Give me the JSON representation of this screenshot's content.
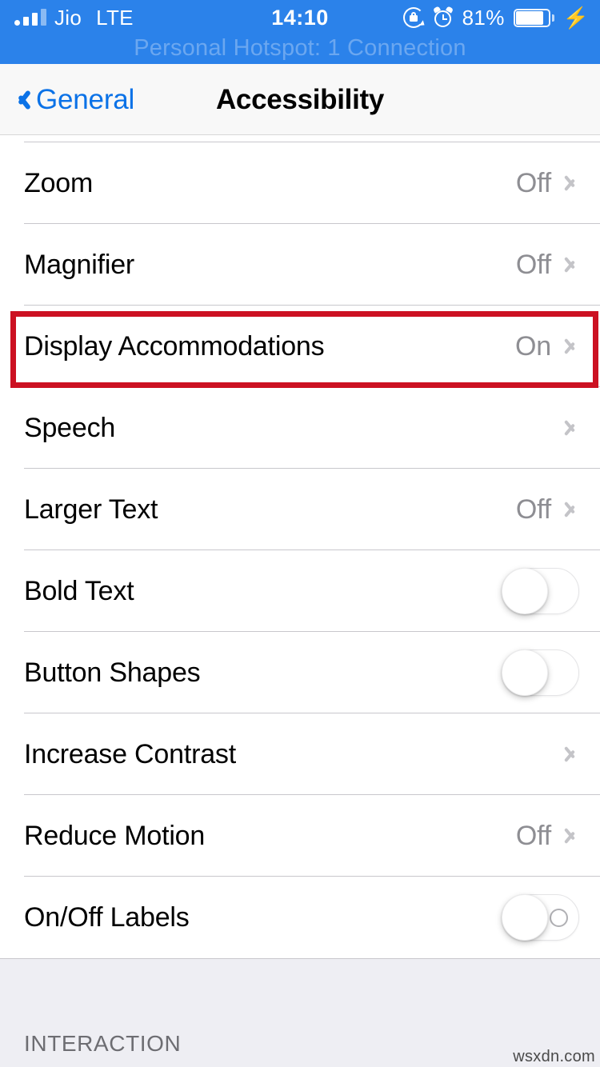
{
  "status_bar": {
    "carrier": "Jio",
    "network": "LTE",
    "time": "14:10",
    "battery_percent": "81%",
    "icons": {
      "signal": "signal-bars-icon",
      "rotation_lock": "rotation-lock-icon",
      "alarm": "alarm-clock-icon",
      "battery": "battery-icon",
      "charging": "charging-bolt-icon"
    },
    "accent_color": "#2b82ea"
  },
  "hotspot_banner": {
    "text": "Personal Hotspot: 1 Connection"
  },
  "nav": {
    "back_label": "General",
    "title": "Accessibility",
    "tint_color": "#0b72e7"
  },
  "vision_section": {
    "rows": [
      {
        "label": "Zoom",
        "value": "Off",
        "control": "chevron"
      },
      {
        "label": "Magnifier",
        "value": "Off",
        "control": "chevron"
      },
      {
        "label": "Display Accommodations",
        "value": "On",
        "control": "chevron",
        "highlighted": true
      },
      {
        "label": "Speech",
        "value": "",
        "control": "chevron"
      },
      {
        "label": "Larger Text",
        "value": "Off",
        "control": "chevron"
      },
      {
        "label": "Bold Text",
        "value": "",
        "control": "switch",
        "switch_on": false
      },
      {
        "label": "Button Shapes",
        "value": "",
        "control": "switch",
        "switch_on": false
      },
      {
        "label": "Increase Contrast",
        "value": "",
        "control": "chevron"
      },
      {
        "label": "Reduce Motion",
        "value": "Off",
        "control": "chevron"
      },
      {
        "label": "On/Off Labels",
        "value": "",
        "control": "switch-labeled",
        "switch_on": false
      }
    ]
  },
  "next_section": {
    "header": "INTERACTION"
  },
  "annotation": {
    "highlight_color": "#cc1122",
    "target_row": "Display Accommodations"
  },
  "watermark": {
    "text": "wsxdn.com"
  }
}
